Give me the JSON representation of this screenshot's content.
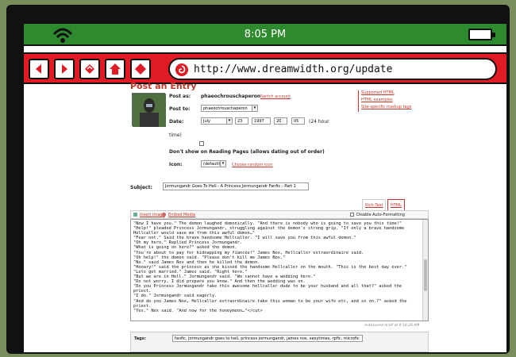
{
  "device": {
    "time": "8:05 PM"
  },
  "browser": {
    "url": "http://www.dreamwidth.org/update",
    "nav_buttons": [
      "back-icon",
      "forward-icon",
      "refresh-icon",
      "home-icon",
      "stop-icon"
    ]
  },
  "form": {
    "heading": "Post an Entry",
    "post_as_label": "Post as:",
    "post_as_value": "phaeochrouschaperon",
    "switch_account": "Switch account",
    "post_to_label": "Post to:",
    "post_to_value": "phaeochrouschaperon",
    "date_label": "Date:",
    "date_month": "July",
    "date_day": "23",
    "date_year": "1997",
    "time_hour": "20",
    "time_min": "05",
    "hour_note": "(24 hour",
    "time_word": "time)",
    "reading_label": "Don't show on Reading Pages (allows dating out of order)",
    "icon_label": "Icon:",
    "icon_value": "(default)",
    "choose_icon": "Choose random icon",
    "subject_label": "Subject:",
    "subject_value": "Jormungandr Goes To Hell - A Princess Jormungandr Fanfic - Part 1",
    "tab_rich": "Rich Text",
    "tab_html": "HTML",
    "insert_image": "Insert image",
    "embed_media": "Embed Media",
    "auto_format": "Disable Auto-Formatting",
    "autosave": "Autosaved draft at 8:18:28 AM",
    "tags_label": "Tags:",
    "tags_value": "fanfic, jormungandr goes to hell, princess jormungandr, james nox, sexytimes, rpfic, microfic"
  },
  "side_links": [
    "Supported HTML",
    "HTML examples",
    "Site-specific markup tags"
  ],
  "entry_text": "\"Now I have you.\" The demon laughed demonically. \"And there is nobody who is going to save you this time!\"\n\"Help!\" pleaded Princess Jormungandr, struggling against the demon's strong grip. \"If only a brave handsome Hellcaller would save me from this awful demon…\"\n\"Fear not.\" Said the brave handsome Hellcaller. \"I will save you from this awful demon.\"\n\"Oh my hero.\" Replied Princess Jormungandr.\n\"What is going on here?\" asked the demon.\n\"You're about to pay for kidnapping my fiancée!\" James Nox, Hellcaller extraordinaire said.\n\"Oh help!\" the demon said. \"Please don't kill me James Nox.\"\n\"No.\" said James Nox and then he killed the demon.\n\"Hooary!\" said the princess as she kissed the handsome Hellcaller on the mouth. \"This is the best day ever.\"\n\"Lets get married.\" James said. \"Right here.\"\n\"But we are in Hell.\" Jormungandr said. \"We cannot have a wedding here.\"\n\"Do not worry, I did prepare you know.\" And then the wedding was on.\n\"Do you Princess Jormungandr take this awesome hellcaller dude to be your husband and all that?\" asked the priest.\n\"I do.\" Jormungandr said eagerly.\n\"And do you James Nox, Hellcaller extraordinaire take this woman to be your wife etc, and so on.?\" asked the priest.\n\"Yes.\" Nox said. \"And now for the honeymoon…\"</cut>"
}
